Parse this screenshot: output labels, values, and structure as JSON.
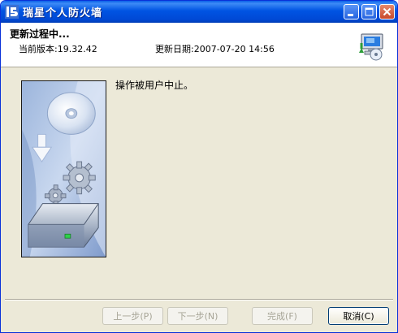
{
  "window": {
    "title": "瑞星个人防火墙",
    "controls": {
      "minimize": "minimize",
      "maximize": "maximize",
      "close": "close"
    }
  },
  "header": {
    "title": "更新过程中...",
    "current_version": "当前版本:19.32.42",
    "update_date": "更新日期:2007-07-20 14:56"
  },
  "body": {
    "message": "操作被用户中止。"
  },
  "buttons": {
    "back": "上一步(P)",
    "next": "下一步(N)",
    "finish": "完成(F)",
    "cancel": "取消(C)"
  },
  "icons": {
    "app": "rising-app-icon",
    "header": "computer-update-icon",
    "banner": "cd-download-gears-drive-illustration"
  },
  "colors": {
    "titlebar": "#0054e3",
    "window_bg": "#ece9d8",
    "button_border": "#003c74"
  }
}
